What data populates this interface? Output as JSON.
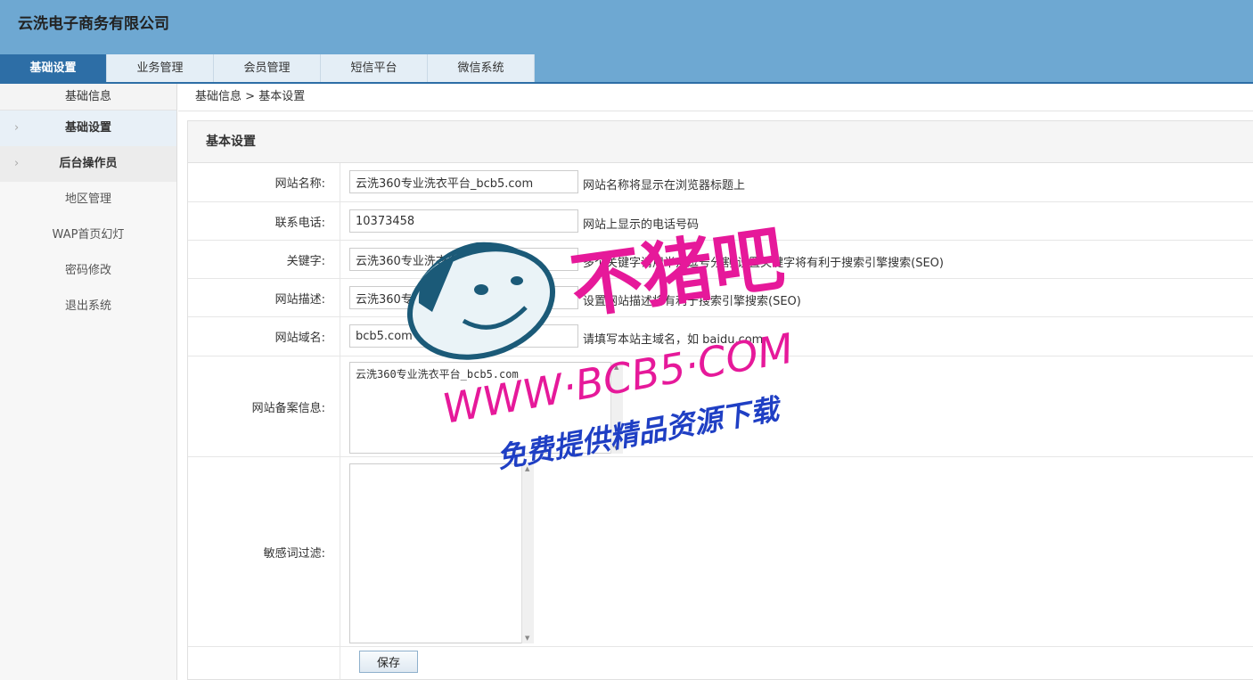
{
  "app": {
    "company": "云洗电子商务有限公司"
  },
  "tabs": [
    "基础设置",
    "业务管理",
    "会员管理",
    "短信平台",
    "微信系统"
  ],
  "sidebar": {
    "header": "基础信息",
    "groups": [
      "基础设置",
      "后台操作员"
    ],
    "items": [
      "地区管理",
      "WAP首页幻灯",
      "密码修改",
      "退出系统"
    ]
  },
  "breadcrumb": {
    "root": "基础信息",
    "sep": ">",
    "current": "基本设置"
  },
  "panel": {
    "title": "基本设置"
  },
  "form": {
    "site_name": {
      "label": "网站名称:",
      "value": "云洗360专业洗衣平台_bcb5.com",
      "tip": "网站名称将显示在浏览器标题上"
    },
    "phone": {
      "label": "联系电话:",
      "value": "10373458",
      "tip": "网站上显示的电话号码"
    },
    "keywords": {
      "label": "关键字:",
      "value": "云洗360专业洗衣平台_bcb5.com",
      "tip": "多个关键字请用半角逗号分割,设置关键字将有利于搜索引擎搜索(SEO)"
    },
    "description": {
      "label": "网站描述:",
      "value": "云洗360专业洗衣平台_bcb5.com",
      "tip": "设置网站描述将有利于搜索引擎搜索(SEO)"
    },
    "domain": {
      "label": "网站域名:",
      "value": "bcb5.com",
      "tip": "请填写本站主域名，如 baidu.com"
    },
    "icp": {
      "label": "网站备案信息:",
      "value": "云洗360专业洗衣平台_bcb5.com"
    },
    "filter": {
      "label": "敏感词过滤:",
      "value": ""
    },
    "save_label": "保存"
  },
  "watermark": {
    "brand": "不猪吧",
    "url": "WWW·BCB5·COM",
    "slogan": "免费提供精品资源下载",
    "colors": {
      "pink": "#e6199a",
      "blue": "#1f3fc4",
      "face": "#1b5a78"
    }
  }
}
